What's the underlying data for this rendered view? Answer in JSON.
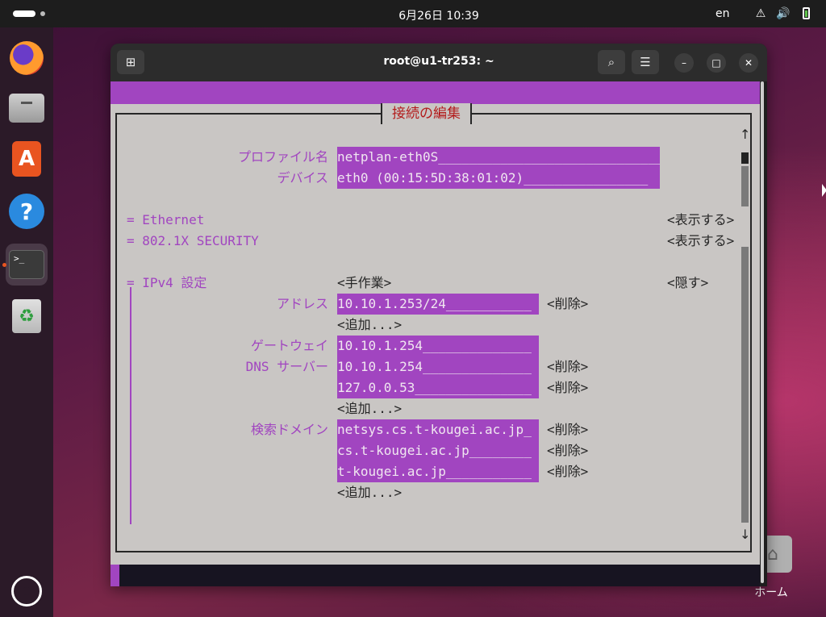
{
  "topbar": {
    "clock": "6月26日  10:39",
    "language": "en"
  },
  "icons": {
    "network": "network-icon",
    "volume": "volume-icon",
    "battery": "battery-icon"
  },
  "dock": {
    "items": [
      "firefox-icon",
      "files-icon",
      "app-center-icon",
      "help-icon",
      "terminal-icon",
      "trash-icon"
    ],
    "active_accent": "#e95420"
  },
  "desktop": {
    "home_label": "ホーム"
  },
  "window": {
    "title": "root@u1-tr253: ~"
  },
  "colors": {
    "accent": "#a145c0",
    "title_red": "#b31b1b",
    "tui_background": "#c9c6c4"
  },
  "form": {
    "title": "接続の編集",
    "profile_label": "プロファイル名",
    "profile_value": "netplan-eth0S_____________________________",
    "device_label": "デバイス",
    "device_value": "eth0 (00:15:5D:38:01:02)________________",
    "ethernet_section": "= Ethernet",
    "ethernet_action": "<表示する>",
    "security_section": "= 802.1X SECURITY",
    "security_action": "<表示する>",
    "ipv4_section": "= IPv4 設定",
    "ipv4_method": "<手作業>",
    "ipv4_action": "<隠す>",
    "address_label": "アドレス",
    "addresses": [
      "10.10.1.253/24___________"
    ],
    "gateway_label": "ゲートウェイ",
    "gateway_value": "10.10.1.254______________",
    "dns_label": "DNS サーバー",
    "dns_servers": [
      "10.10.1.254______________",
      "127.0.0.53_______________"
    ],
    "search_label": "検索ドメイン",
    "search_domains": [
      "netsys.cs.t-kougei.ac.jp_",
      "cs.t-kougei.ac.jp________",
      "t-kougei.ac.jp___________"
    ],
    "delete_label": "<削除>",
    "add_label": "<追加...>",
    "scroll_up": "↑",
    "scroll_down": "↓"
  }
}
